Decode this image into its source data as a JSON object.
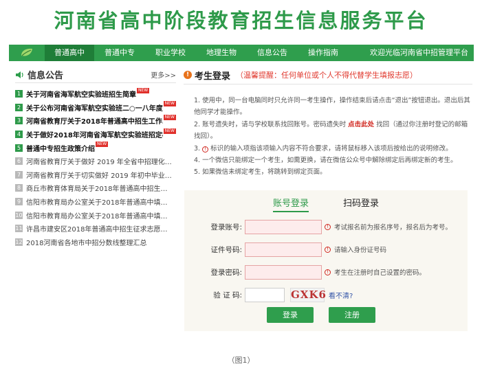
{
  "site_title": "河南省高中阶段教育招生信息服务平台",
  "nav": {
    "items": [
      "普通高中",
      "普通中专",
      "职业学校",
      "地理生物",
      "信息公告",
      "操作指南"
    ],
    "welcome": "欢迎光临河南省中招管理平台"
  },
  "news": {
    "title": "信息公告",
    "more": "更多>>",
    "items": [
      {
        "num": "1",
        "text": "关于河南省海军航空实验班招生简章",
        "new": "NEW"
      },
      {
        "num": "2",
        "text": "关于公布河南省海军航空实验班二○一八年度…",
        "new": "NEW"
      },
      {
        "num": "3",
        "text": "河南省教育厅关于2018年普通高中招生工作…",
        "new": "NEW"
      },
      {
        "num": "4",
        "text": "关于做好2018年河南省海军航空实验班招定检…",
        "new": "NEW"
      },
      {
        "num": "5",
        "text": "普通中专招生政策介绍",
        "new": "NEW"
      },
      {
        "num": "6",
        "text": "河南省教育厅关于做好 2019 年全省中招理化…",
        "new": ""
      },
      {
        "num": "7",
        "text": "河南省教育厅关于切实做好 2019 年初中毕业…",
        "new": ""
      },
      {
        "num": "8",
        "text": "商丘市教育体育局关于2018年普通高中招生…",
        "new": ""
      },
      {
        "num": "9",
        "text": "信阳市教育局办公室关于2018年普通高中填…",
        "new": ""
      },
      {
        "num": "10",
        "text": "信阳市教育局办公室关于2018年普通高中填…",
        "new": ""
      },
      {
        "num": "11",
        "text": "许昌市建安区2018年普通高中招生征求志愿…",
        "new": ""
      },
      {
        "num": "12",
        "text": "2018河南省各地市中招分数线整理汇总",
        "new": ""
      }
    ]
  },
  "login": {
    "title": "考生登录",
    "note": "（温馨提醒：任何单位或个人不得代替学生填报志愿）",
    "warn_icon": "!",
    "instructions": {
      "i1": "1. 使用中，同一台电脑同时只允许同一考生操作，操作结束后请点击“退出”按钮退出。退出后其他同学才能操作。",
      "i2_pre": "2. 账号遗失时，请与学校联系找回账号。密码遗失时 ",
      "i2_link": "点击此处",
      "i2_post": " 找回（通过你注册时登记的邮箱找回）。",
      "i3_pre": "3. ",
      "i3_icon": "!",
      "i3_post": " 标识的输入项指该项输入内容不符合要求，请将鼠标移入该项后按给出的说明修改。",
      "i4": "4. 一个微信只能绑定一个考生，如需更换，请在微信公众号中解除绑定后再绑定新的考生。",
      "i5": "5. 如果微信未绑定考生，将跳转到绑定页面。"
    },
    "tabs": [
      "账号登录",
      "扫码登录"
    ],
    "fields": {
      "account_label": "登录账号:",
      "account_hint": "考试报名前为报名序号，报名后为考号。",
      "id_label": "证件号码:",
      "id_hint": "请输入身份证号码",
      "password_label": "登录密码:",
      "password_hint": "考生在注册时自己设置的密码。",
      "captcha_label": "验  证  码:",
      "captcha_text": "GXK6",
      "captcha_refresh": "看不清?",
      "hint_icon": "!"
    },
    "login_btn": "登录",
    "register_btn": "注册"
  },
  "caption": "（图1）",
  "colors": {
    "brand": "#2f9e4d",
    "warn": "#e03a2f"
  }
}
